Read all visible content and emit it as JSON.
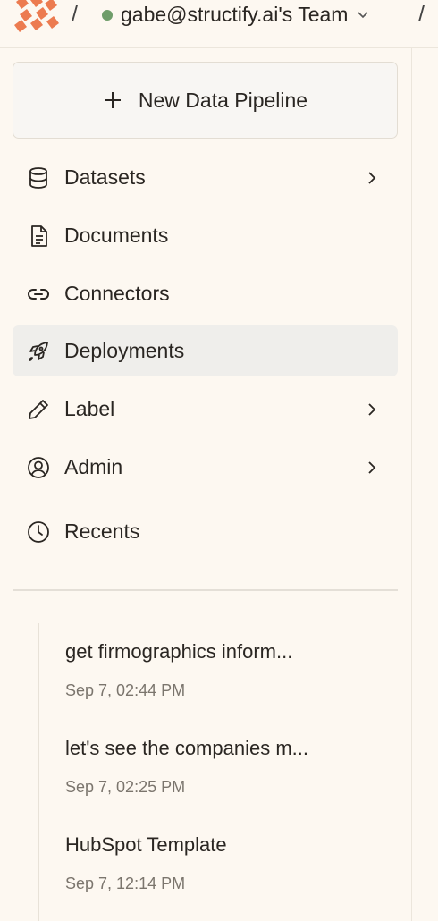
{
  "header": {
    "separator": "/",
    "team_name": "gabe@structify.ai's Team",
    "status_color": "#6f9d6a",
    "logo_color": "#ec7b50"
  },
  "sidebar": {
    "new_pipeline_label": "New Data Pipeline",
    "items": [
      {
        "label": "Datasets",
        "icon": "database-icon",
        "has_chevron": true
      },
      {
        "label": "Documents",
        "icon": "document-icon",
        "has_chevron": false
      },
      {
        "label": "Connectors",
        "icon": "link-icon",
        "has_chevron": false
      },
      {
        "label": "Deployments",
        "icon": "rocket-icon",
        "has_chevron": false,
        "active": true
      },
      {
        "label": "Label",
        "icon": "pencil-icon",
        "has_chevron": true
      },
      {
        "label": "Admin",
        "icon": "user-circle-icon",
        "has_chevron": true
      },
      {
        "label": "Recents",
        "icon": "clock-icon",
        "has_chevron": false
      }
    ],
    "recents": [
      {
        "title": "get firmographics inform...",
        "time": "Sep 7, 02:44 PM"
      },
      {
        "title": "let's see the companies m...",
        "time": "Sep 7, 02:25 PM"
      },
      {
        "title": "HubSpot Template",
        "time": "Sep 7, 12:14 PM"
      }
    ]
  }
}
